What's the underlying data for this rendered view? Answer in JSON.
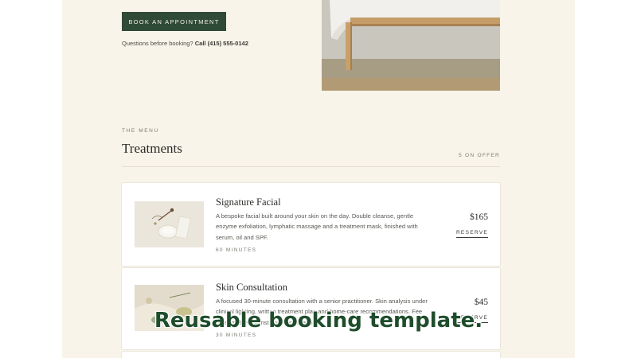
{
  "hero": {
    "book_button": "BOOK AN APPOINTMENT",
    "questions_text": "Questions before booking? ",
    "call_text": "Call (415) 555-0142"
  },
  "menu": {
    "eyebrow": "THE MENU",
    "title": "Treatments",
    "count_label": "5 ON OFFER"
  },
  "treatments": [
    {
      "name": "Signature Facial",
      "description": "A bespoke facial built around your skin on the day. Double cleanse, gentle enzyme exfoliation, lymphatic massage and a treatment mask, finished with serum, oil and SPF.",
      "duration": "60 MINUTES",
      "price": "$165",
      "reserve": "RESERVE"
    },
    {
      "name": "Skin Consultation",
      "description": "A focused 30-minute consultation with a senior practitioner. Skin analysis under clinical lighting, written treatment plan and home-care recommendations. Fee redeemable against your first treatment.",
      "duration": "30 MINUTES",
      "price": "$45",
      "reserve": "RESERVE"
    }
  ],
  "overlay": {
    "caption": "Reusable booking template."
  },
  "colors": {
    "page_background": "#f8f4ea",
    "button_green": "#2f4a36",
    "caption_green": "#1f4d2c",
    "card_background": "#ffffff"
  }
}
